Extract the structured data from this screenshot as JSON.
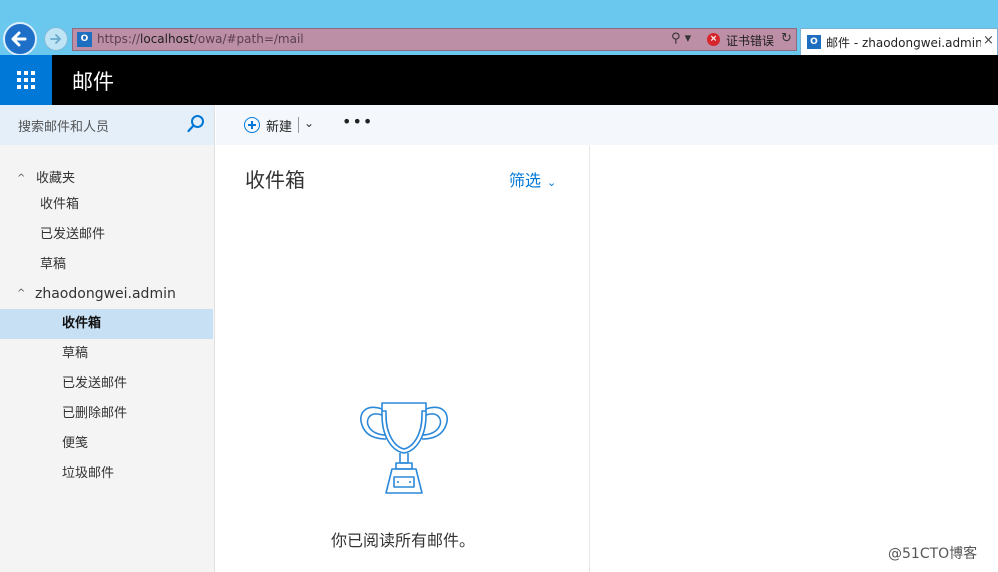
{
  "browser": {
    "address": {
      "prefix": "https://",
      "host": "localhost",
      "path": "/owa/#path=/mail",
      "cert_error": "证书错误"
    },
    "tab": {
      "title": "邮件 - zhaodongwei.admin..."
    }
  },
  "app": {
    "title": "邮件"
  },
  "search": {
    "placeholder": "搜索邮件和人员"
  },
  "commands": {
    "new_label": "新建",
    "more_label": "•••"
  },
  "nav": {
    "favorites_header": "收藏夹",
    "favorites": [
      "收件箱",
      "已发送邮件",
      "草稿"
    ],
    "account_header": "zhaodongwei.admin",
    "folders": [
      "收件箱",
      "草稿",
      "已发送邮件",
      "已删除邮件",
      "便笺",
      "垃圾邮件"
    ],
    "selected": "收件箱"
  },
  "list": {
    "title": "收件箱",
    "filter_label": "筛选",
    "empty_message": "你已阅读所有邮件。"
  },
  "watermark": "@51CTO博客",
  "colors": {
    "accent": "#0078d7",
    "waffle_bg": "#0078d7",
    "topbar_bg": "#000000",
    "selected_bg": "#c7e0f4",
    "chrome_bg": "#6ac8ee"
  }
}
